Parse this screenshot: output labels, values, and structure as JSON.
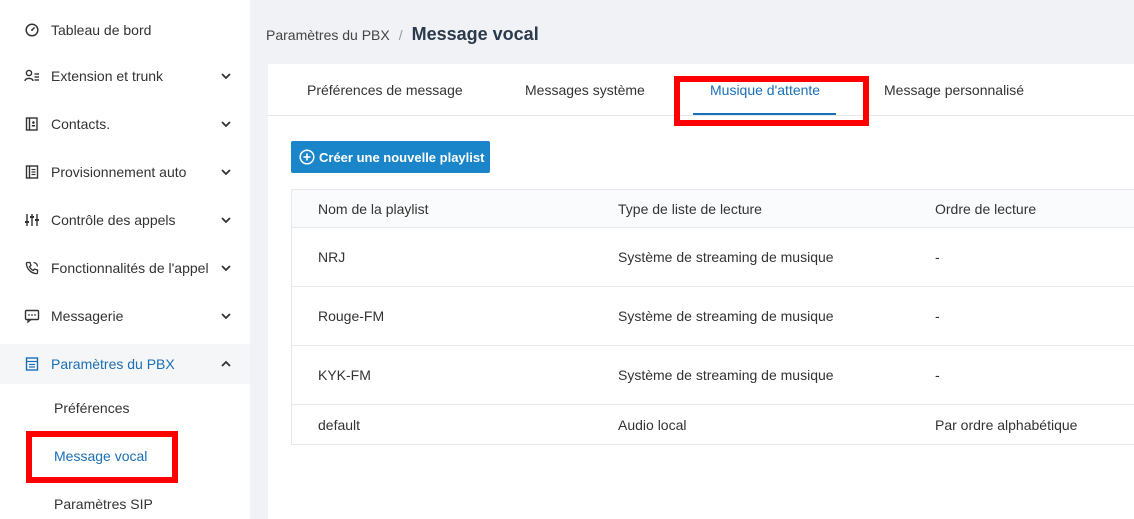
{
  "sidebar": {
    "items": [
      {
        "label": "Tableau de bord",
        "icon": "gauge-icon",
        "expandable": false
      },
      {
        "label": "Extension et trunk",
        "icon": "user-list-icon",
        "expandable": true
      },
      {
        "label": "Contacts.",
        "icon": "contacts-book-icon",
        "expandable": true
      },
      {
        "label": "Provisionnement auto",
        "icon": "provision-document-icon",
        "expandable": true
      },
      {
        "label": "Contrôle des appels",
        "icon": "sliders-icon",
        "expandable": true
      },
      {
        "label": "Fonctionnalités de l'appel",
        "icon": "phone-icon",
        "expandable": true
      },
      {
        "label": "Messagerie",
        "icon": "message-icon",
        "expandable": true
      },
      {
        "label": "Paramètres du PBX",
        "icon": "settings-list-icon",
        "expandable": true,
        "expanded": true,
        "active": true
      }
    ],
    "subitems": [
      {
        "label": "Préférences",
        "active": false
      },
      {
        "label": "Message vocal",
        "active": true
      },
      {
        "label": "Paramètres SIP",
        "active": false
      }
    ]
  },
  "breadcrumb": {
    "parent": "Paramètres du PBX",
    "separator": "/",
    "current": "Message vocal"
  },
  "tabs": [
    {
      "label": "Préférences de message",
      "active": false
    },
    {
      "label": "Messages système",
      "active": false
    },
    {
      "label": "Musique d'attente",
      "active": true
    },
    {
      "label": "Message personnalisé",
      "active": false
    }
  ],
  "create_button": {
    "label": "Créer une nouvelle playlist",
    "icon": "plus-circle-icon"
  },
  "table": {
    "columns": [
      "Nom de la playlist",
      "Type de liste de lecture",
      "Ordre de lecture"
    ],
    "rows": [
      [
        "NRJ",
        "Système de streaming de musique",
        "-"
      ],
      [
        "Rouge-FM",
        "Système de streaming de musique",
        "-"
      ],
      [
        "KYK-FM",
        "Système de streaming de musique",
        "-"
      ],
      [
        "default",
        "Audio local",
        "Par ordre alphabétique"
      ]
    ]
  },
  "colors": {
    "accent": "#1a6fb5",
    "button": "#1a85c8",
    "highlight": "#ff0000"
  }
}
